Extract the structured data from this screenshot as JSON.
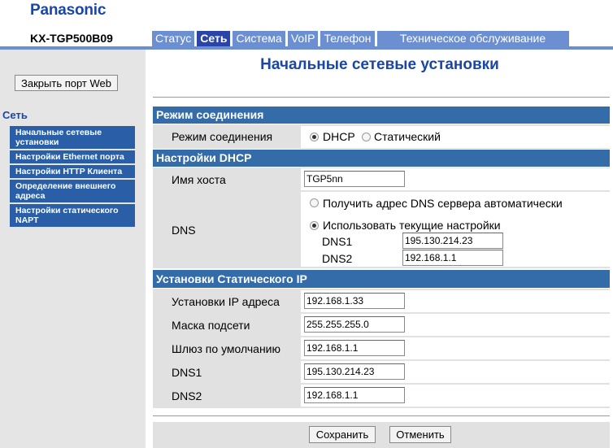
{
  "brand": "Panasonic",
  "model": "KX-TGP500B09",
  "tabs": [
    "Статус",
    "Сеть",
    "Система",
    "VoIP",
    "Телефон",
    "Техническое обслуживание"
  ],
  "sidebar": {
    "close_button": "Закрыть порт Web",
    "title": "Сеть",
    "items": [
      "Начальные сетевые установки",
      "Настройки Ethernet порта",
      "Настройки HTTP Клиента",
      "Определение внешнего адреса",
      "Настройки статического NAPT"
    ]
  },
  "page_title": "Начальные сетевые установки",
  "sections": {
    "mode": {
      "header": "Режим соединения",
      "label": "Режим соединения",
      "option_dhcp": "DHCP",
      "option_static": "Статический",
      "selected": "DHCP"
    },
    "dhcp": {
      "header": "Настройки DHCP",
      "hostname_label": "Имя хоста",
      "hostname_value": "TGP5nn",
      "dns_label": "DNS",
      "dns_auto": "Получить адрес DNS сервера автоматически",
      "dns_current": "Использовать текущие настройки",
      "dns1_label": "DNS1",
      "dns1_value": "195.130.214.23",
      "dns2_label": "DNS2",
      "dns2_value": "192.168.1.1"
    },
    "static": {
      "header": "Установки Статического IP",
      "ip_label": "Установки IP адреса",
      "ip_value": "192.168.1.33",
      "mask_label": "Маска подсети",
      "mask_value": "255.255.255.0",
      "gateway_label": "Шлюз по умолчанию",
      "gateway_value": "192.168.1.1",
      "dns1_label": "DNS1",
      "dns1_value": "195.130.214.23",
      "dns2_label": "DNS2",
      "dns2_value": "192.168.1.1"
    }
  },
  "buttons": {
    "save": "Сохранить",
    "cancel": "Отменить"
  }
}
